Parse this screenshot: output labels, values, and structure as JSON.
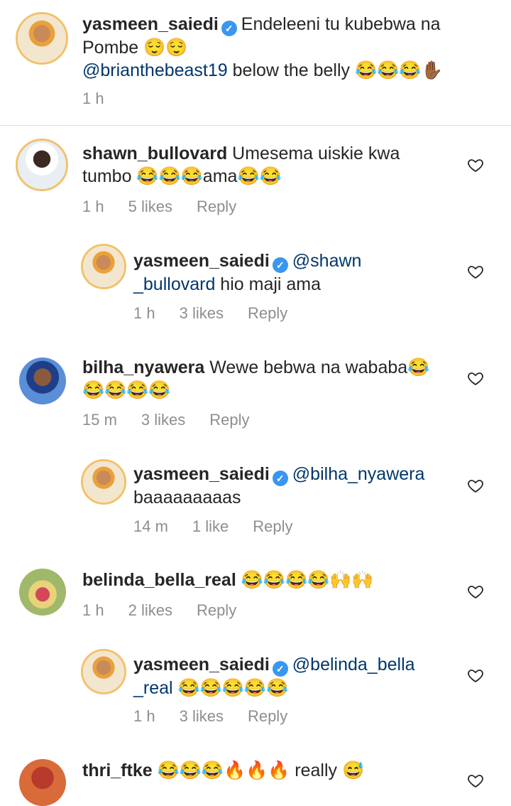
{
  "caption": {
    "username": "yasmeen_saiedi",
    "text_line1": "Endeleeni tu kubebwa na",
    "text_line2": "Pombe 😌😌",
    "mention": "@brianthebeast19",
    "text_line3": " below the belly 😂😂😂✋🏾",
    "time": "1 h"
  },
  "comments": [
    {
      "username": "shawn_bullovard",
      "line1": " Umesema uiskie kwa",
      "line2": "tumbo 😂😂😂ama😂😂",
      "time": "1 h",
      "likes": "5 likes",
      "reply": "Reply"
    },
    {
      "username": "yasmeen_saiedi",
      "mention1": "@shawn",
      "mention2": "_bullovard",
      "line2": " hio maji ama",
      "time": "1 h",
      "likes": "3 likes",
      "reply": "Reply"
    },
    {
      "username": "bilha_nyawera",
      "line1": " Wewe bebwa na wababa😂",
      "line2": "😂😂😂😂",
      "time": "15 m",
      "likes": "3 likes",
      "reply": "Reply"
    },
    {
      "username": "yasmeen_saiedi",
      "mention1": "@bilha_nyawera",
      "line2": "baaaaaaaaas",
      "time": "14 m",
      "likes": "1 like",
      "reply": "Reply"
    },
    {
      "username": "belinda_bella_real",
      "line1": " 😂😂😂😂🙌🙌",
      "time": "1 h",
      "likes": "2 likes",
      "reply": "Reply"
    },
    {
      "username": "yasmeen_saiedi",
      "mention1": "@belinda_bella",
      "mention2": "_real",
      "line2": " 😂😂😂😂😂",
      "time": "1 h",
      "likes": "3 likes",
      "reply": "Reply"
    },
    {
      "username": "thri_ftke",
      "line1": " 😂😂😂🔥🔥🔥 really 😅"
    }
  ],
  "icons": {
    "heart": "heart-outline-icon",
    "verified": "verified-badge-icon"
  }
}
